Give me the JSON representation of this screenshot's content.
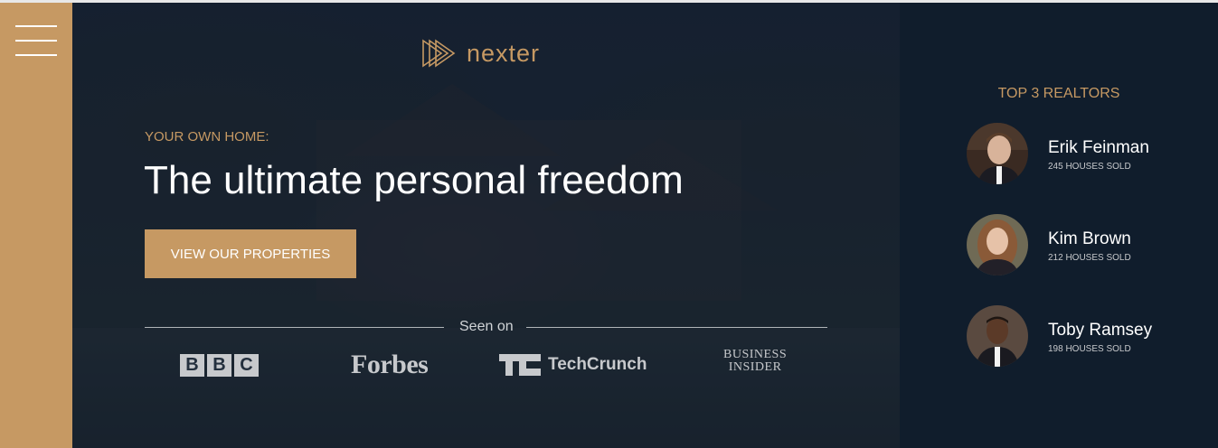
{
  "sidebar": {
    "menu_icon": "hamburger-menu-icon",
    "color": "#c69963"
  },
  "brand": {
    "logo_text": "nexter",
    "logo_icon": "triple-triangle-logo-icon",
    "accent": "#c69963"
  },
  "hero": {
    "subtitle": "YOUR OWN HOME:",
    "heading": "The ultimate personal freedom",
    "cta_label": "VIEW OUR PROPERTIES",
    "seen_on": "Seen on",
    "press": {
      "bbc": [
        "B",
        "B",
        "C"
      ],
      "forbes": "Forbes",
      "techcrunch": "TechCrunch",
      "business_insider": [
        "BUSINESS",
        "INSIDER"
      ]
    }
  },
  "realtors": {
    "title": "TOP 3 REALTORS",
    "items": [
      {
        "name": "Erik Feinman",
        "sold": "245 HOUSES SOLD"
      },
      {
        "name": "Kim Brown",
        "sold": "212 HOUSES SOLD"
      },
      {
        "name": "Toby Ramsey",
        "sold": "198 HOUSES SOLD"
      }
    ]
  }
}
